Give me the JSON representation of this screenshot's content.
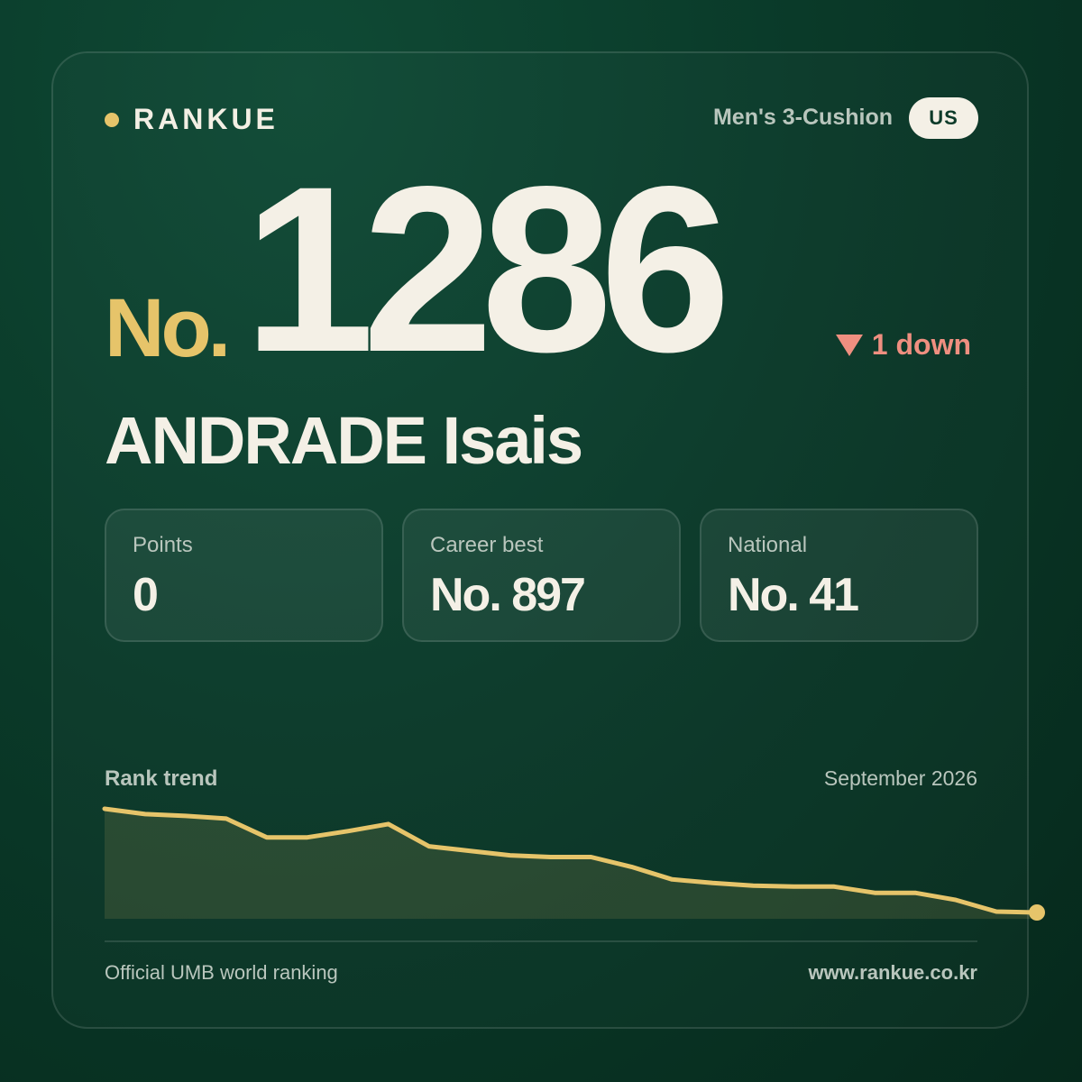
{
  "brand": {
    "name": "RANKUE"
  },
  "header": {
    "category": "Men's 3-Cushion",
    "country": "US"
  },
  "rank": {
    "prefix": "No.",
    "number": "1286",
    "change_text": "1 down",
    "change_direction": "down"
  },
  "player": {
    "name": "ANDRADE Isais"
  },
  "stats": [
    {
      "label": "Points",
      "value": "0"
    },
    {
      "label": "Career best",
      "value": "No. 897"
    },
    {
      "label": "National",
      "value": "No. 41"
    }
  ],
  "trend": {
    "title": "Rank trend",
    "date": "September 2026"
  },
  "footer": {
    "source": "Official UMB world ranking",
    "url": "www.rankue.co.kr"
  },
  "colors": {
    "accent": "#e6c46a",
    "down": "#ef8f80",
    "text": "#f4f0e6",
    "muted": "#b9c6bd"
  },
  "chart_data": {
    "type": "area",
    "title": "Rank trend",
    "y_inverted": true,
    "series": [
      {
        "values": [
          1170,
          1176,
          1178,
          1181,
          1202,
          1202,
          1195,
          1187,
          1212,
          1217,
          1222,
          1224,
          1224,
          1235,
          1249,
          1253,
          1256,
          1257,
          1257,
          1264,
          1264,
          1272,
          1285,
          1286
        ]
      }
    ]
  }
}
